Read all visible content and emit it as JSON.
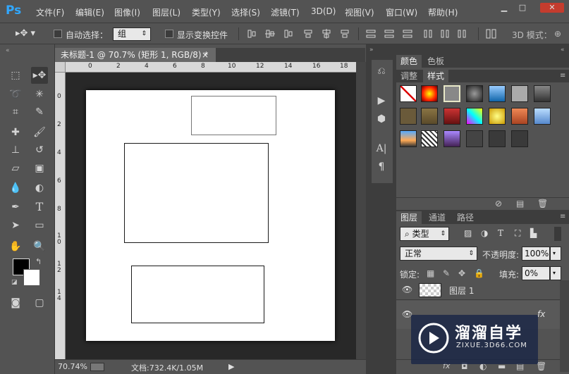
{
  "app": {
    "logo": "Ps"
  },
  "menu": [
    "文件(F)",
    "编辑(E)",
    "图像(I)",
    "图层(L)",
    "类型(Y)",
    "选择(S)",
    "滤镜(T)",
    "3D(D)",
    "视图(V)",
    "窗口(W)",
    "帮助(H)"
  ],
  "window_controls": {
    "minimize": "▁",
    "maximize": "□",
    "close": "✕"
  },
  "options": {
    "auto_select_label": "自动选择：",
    "auto_select_value": "组",
    "show_transform_label": "显示变换控件",
    "mode_3d_label": "3D 模式："
  },
  "document": {
    "tab_title": "未标题-1 @ 70.7% (矩形 1, RGB/8) *",
    "close": "×",
    "ruler_top_ticks": [
      "0",
      "2",
      "4",
      "6",
      "8",
      "10",
      "12",
      "14",
      "16",
      "18"
    ],
    "ruler_left_ticks": [
      "0",
      "2",
      "4",
      "6",
      "8",
      "1 0",
      "1 2",
      "1 4"
    ]
  },
  "status": {
    "zoom": "70.74%",
    "doc_info": "文档:732.4K/1.05M"
  },
  "color_panel": {
    "tabs": [
      "颜色",
      "色板"
    ],
    "subtabs": [
      "调整",
      "样式"
    ]
  },
  "layers_panel": {
    "tabs": [
      "图层",
      "通道",
      "路径"
    ],
    "filter_kind": "类型",
    "blend_mode": "正常",
    "opacity_label": "不透明度:",
    "opacity_value": "100%",
    "lock_label": "锁定:",
    "fill_label": "填充:",
    "fill_value": "0%",
    "layer_name": "图层 1",
    "fx": "fx"
  },
  "watermark": {
    "brand": "溜溜自学",
    "url": "ZIXUE.3D66.COM"
  },
  "colors": {
    "accent": "#31a8ff",
    "bg": "#535353",
    "canvas": "#ffffff",
    "pasteboard": "#282828"
  }
}
